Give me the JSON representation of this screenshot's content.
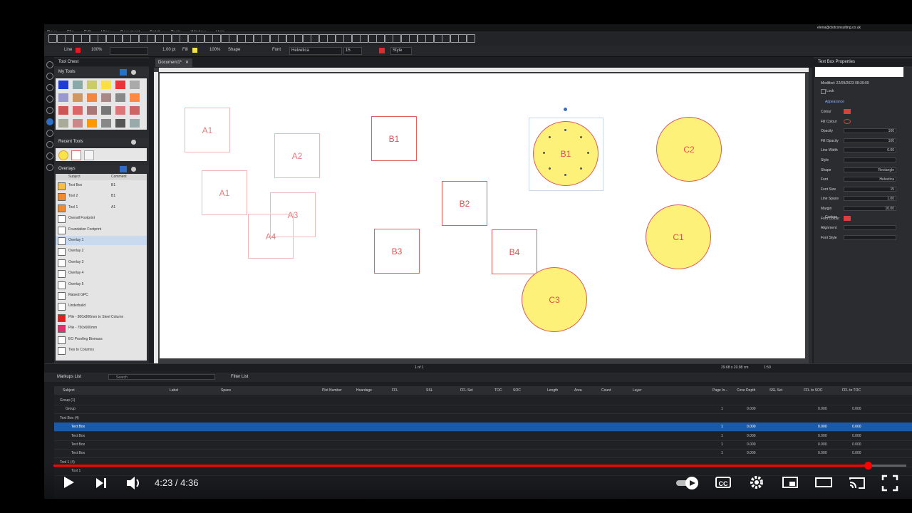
{
  "menu": [
    "Revu",
    "File",
    "Edit",
    "View",
    "Document",
    "Batch",
    "Tools",
    "Window",
    "Help"
  ],
  "user_email": "elena@dsitconsulting.co.uk",
  "toolbar2": {
    "line_label": "Line",
    "opacity1": "100%",
    "width_value": "1.00 pt",
    "fill_label": "Fill",
    "opacity2": "100%",
    "shape_label": "Shape",
    "font_label": "Font",
    "font_value": "Helvetica",
    "size_value": "15",
    "style_label": "Style"
  },
  "document_tab": "Document1*",
  "left_panel": {
    "tool_chest_title": "Tool Chest",
    "my_tools": "My Tools",
    "recent_tools": "Recent Tools",
    "overlays_title": "Overlays",
    "col_subject": "Subject",
    "col_comment": "Comment",
    "items": [
      {
        "label": "Text Box",
        "comment": "B1"
      },
      {
        "label": "Tool 2",
        "comment": "B1"
      },
      {
        "label": "Tool 1",
        "comment": "A1"
      },
      {
        "label": "Overall Footprint",
        "comment": ""
      },
      {
        "label": "Foundation Footprint",
        "comment": ""
      },
      {
        "label": "Overlay 1",
        "comment": ""
      },
      {
        "label": "Overlay 2",
        "comment": ""
      },
      {
        "label": "Overlay 3",
        "comment": ""
      },
      {
        "label": "Overlay 4",
        "comment": ""
      },
      {
        "label": "Overlay 5",
        "comment": ""
      },
      {
        "label": "Raised GPC",
        "comment": ""
      },
      {
        "label": "Underbuild",
        "comment": ""
      },
      {
        "label": "Pile - 800x800mm to Steel Column",
        "comment": ""
      },
      {
        "label": "Pile - 750x600mm",
        "comment": ""
      },
      {
        "label": "EO Proofing Biomass",
        "comment": ""
      },
      {
        "label": "Ties to Columns",
        "comment": ""
      }
    ]
  },
  "canvas_shapes": {
    "a1_top": "A1",
    "a2": "A2",
    "a1_mid": "A1",
    "a3": "A3",
    "a4": "A4",
    "b1_square": "B1",
    "b2": "B2",
    "b3": "B3",
    "b4": "B4",
    "b1_circle": "B1",
    "c2": "C2",
    "c1": "C1",
    "c3": "C3"
  },
  "right_panel": {
    "title": "Text Box Properties",
    "modified": "Modified: 22/09/2023 08:39:09",
    "lock": "Lock",
    "appearance": "Appearance",
    "rows": [
      {
        "label": "Colour",
        "value": ""
      },
      {
        "label": "Fill Colour",
        "value": ""
      },
      {
        "label": "Opacity",
        "value": "100"
      },
      {
        "label": "Fill Opacity",
        "value": "100"
      },
      {
        "label": "Line Width",
        "value": "0.00"
      },
      {
        "label": "Style",
        "value": ""
      },
      {
        "label": "Shape",
        "value": "Rectangle"
      },
      {
        "label": "Font",
        "value": "Helvetica"
      },
      {
        "label": "Font Size",
        "value": "15"
      },
      {
        "label": "Line Space",
        "value": "1.00"
      },
      {
        "label": "Margin",
        "value": "10.00"
      },
      {
        "label": "Font Colour",
        "value": ""
      },
      {
        "label": "Alignment",
        "value": ""
      },
      {
        "label": "Font Style",
        "value": ""
      }
    ],
    "custom": "Custom"
  },
  "statusbar": {
    "page": "1 of 1",
    "size": "29.68 x 20.98 cm",
    "scale": "1:50"
  },
  "markups": {
    "title": "Markups List",
    "search_placeholder": "Search",
    "filter": "Filter List",
    "columns": [
      "Subject",
      "Label",
      "Space",
      "Plot Number",
      "Hoardage",
      "FFL",
      "SSL",
      "FFL Set",
      "TOC",
      "SOC",
      "Length",
      "Area",
      "Count",
      "Layer",
      "Page In...",
      "Cove Depth",
      "SSL Set",
      "FFL to SOC",
      "FFL to TOC"
    ],
    "rows": [
      {
        "subject": "Group (1)",
        "indent": 0,
        "sel": false,
        "vals": [
          "",
          "",
          "",
          ""
        ]
      },
      {
        "subject": "Group",
        "indent": 1,
        "sel": false,
        "vals": [
          "1",
          "0.000",
          "0.000",
          "0.000"
        ]
      },
      {
        "subject": "Text Box (4)",
        "indent": 0,
        "sel": false,
        "vals": [
          "",
          "",
          "",
          ""
        ]
      },
      {
        "subject": "Text Box",
        "indent": 2,
        "sel": true,
        "vals": [
          "1",
          "0.000",
          "0.000",
          "0.000"
        ]
      },
      {
        "subject": "Text Box",
        "indent": 2,
        "sel": false,
        "vals": [
          "1",
          "0.000",
          "0.000",
          "0.000"
        ]
      },
      {
        "subject": "Text Box",
        "indent": 2,
        "sel": false,
        "vals": [
          "1",
          "0.000",
          "0.000",
          "0.000"
        ]
      },
      {
        "subject": "Text Box",
        "indent": 2,
        "sel": false,
        "vals": [
          "1",
          "0.000",
          "0.000",
          "0.000"
        ]
      },
      {
        "subject": "Tool 1 (4)",
        "indent": 0,
        "sel": false,
        "vals": [
          "",
          "",
          "",
          ""
        ]
      },
      {
        "subject": "Tool 1",
        "indent": 2,
        "sel": false,
        "vals": [
          "",
          "",
          "",
          ""
        ]
      }
    ]
  },
  "video": {
    "time": "4:23 / 4:36",
    "progress": 0.955,
    "cc_label": "CC"
  }
}
